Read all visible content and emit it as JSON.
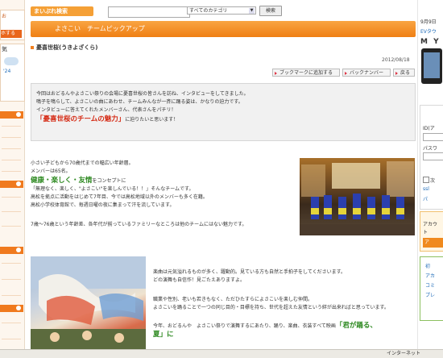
{
  "header": {
    "logo_text": "まいぷれ検索",
    "search_value": "",
    "category_selected": "すべてのカテゴリ",
    "search_button": "検索"
  },
  "page": {
    "title_bar": "よさこい　チームピックアップ",
    "subtitle": "憂喜世桜(うきよざくら)",
    "date": "2012/08/18",
    "toolbar": {
      "bookmark": "ブックマークに追加する",
      "back_number": "バックナンバー",
      "back": "戻る"
    }
  },
  "intro": {
    "line1": "今回はおどるんやよさこい祭りの会場に憂喜世桜の皆さんを訪ね、インタビューをしてきました。",
    "line2": "鳴子を鳴らして、よさこいの曲にあわせ、チームみんなが一斉に踊る姿は、かなりの迫力です。",
    "line3": "インタビューに答えてくれたメンバーさん、代表さんをパチリ！",
    "highlight": "「憂喜世桜のチームの魅力」",
    "line4_suffix": "に迫りたいと思います！"
  },
  "section1": {
    "p1": "小さい子どもから70歳代までの幅広い年齢層。",
    "p2": "メンバーは65名。",
    "concept_green": "健康・楽しく・友情",
    "concept_suffix": "をコンセプトに",
    "p3": "「無理なく、楽しく、\"よさこい\"を楽しんでいる！！」そんなチームです。",
    "p4": "高松を拠点に活動をはじめて7年目、今では高松地域以外のメンバーも多く在籍。",
    "p5": "高松小学校体育館で、毎週日曜の夜に集まって汗を流しています。",
    "p6": "7歳〜76歳という年齢差、各年代が揃っているファミリーなところは他のチームにはない魅力です。"
  },
  "section2": {
    "p1": "楽曲は元気溢れるものが多く、躍動的。見ている方も自然と手拍子をしてくださいます。",
    "p2": "どの演舞も自信作！見ごたえありますよ。",
    "p3": "職業や性別、老いも若きもなく、ただひたすらによさこいを楽しむ仲間。",
    "p4": "よさこいを踊ることで一つの同じ目的・目標を持ち、世代を超えた友情という絆が出来ればと思っています。",
    "p5": "今年、おどるんや　よさこい祭りで演舞するにあたり、踊り、楽曲、衣装すべて映画",
    "p5_green": "「君が踊る、",
    "p6_green": "夏」に"
  },
  "left_col": {
    "item1": "お",
    "item2": "ホする",
    "weather": "気",
    "weather_temp": "'24"
  },
  "right_col": {
    "date_line": "9月9日",
    "ev_line": "EVタウ",
    "brand": "M Y",
    "id_label": "ID(ア",
    "pass_label": "パスワ",
    "check_label": "次",
    "link1": "ssl",
    "link2": "パ",
    "ad1": "アカウ",
    "ad2": "ト",
    "btn": "ア",
    "nav1": "初",
    "nav2": "アカ",
    "nav3": "コミ",
    "nav4": "プレ"
  },
  "status": {
    "text": "インターネット"
  },
  "colors": {
    "accent_orange": "#f08020",
    "highlight_red": "#d52a14",
    "concept_green": "#2f8a22",
    "intro_bg": "#f1f1f1"
  }
}
